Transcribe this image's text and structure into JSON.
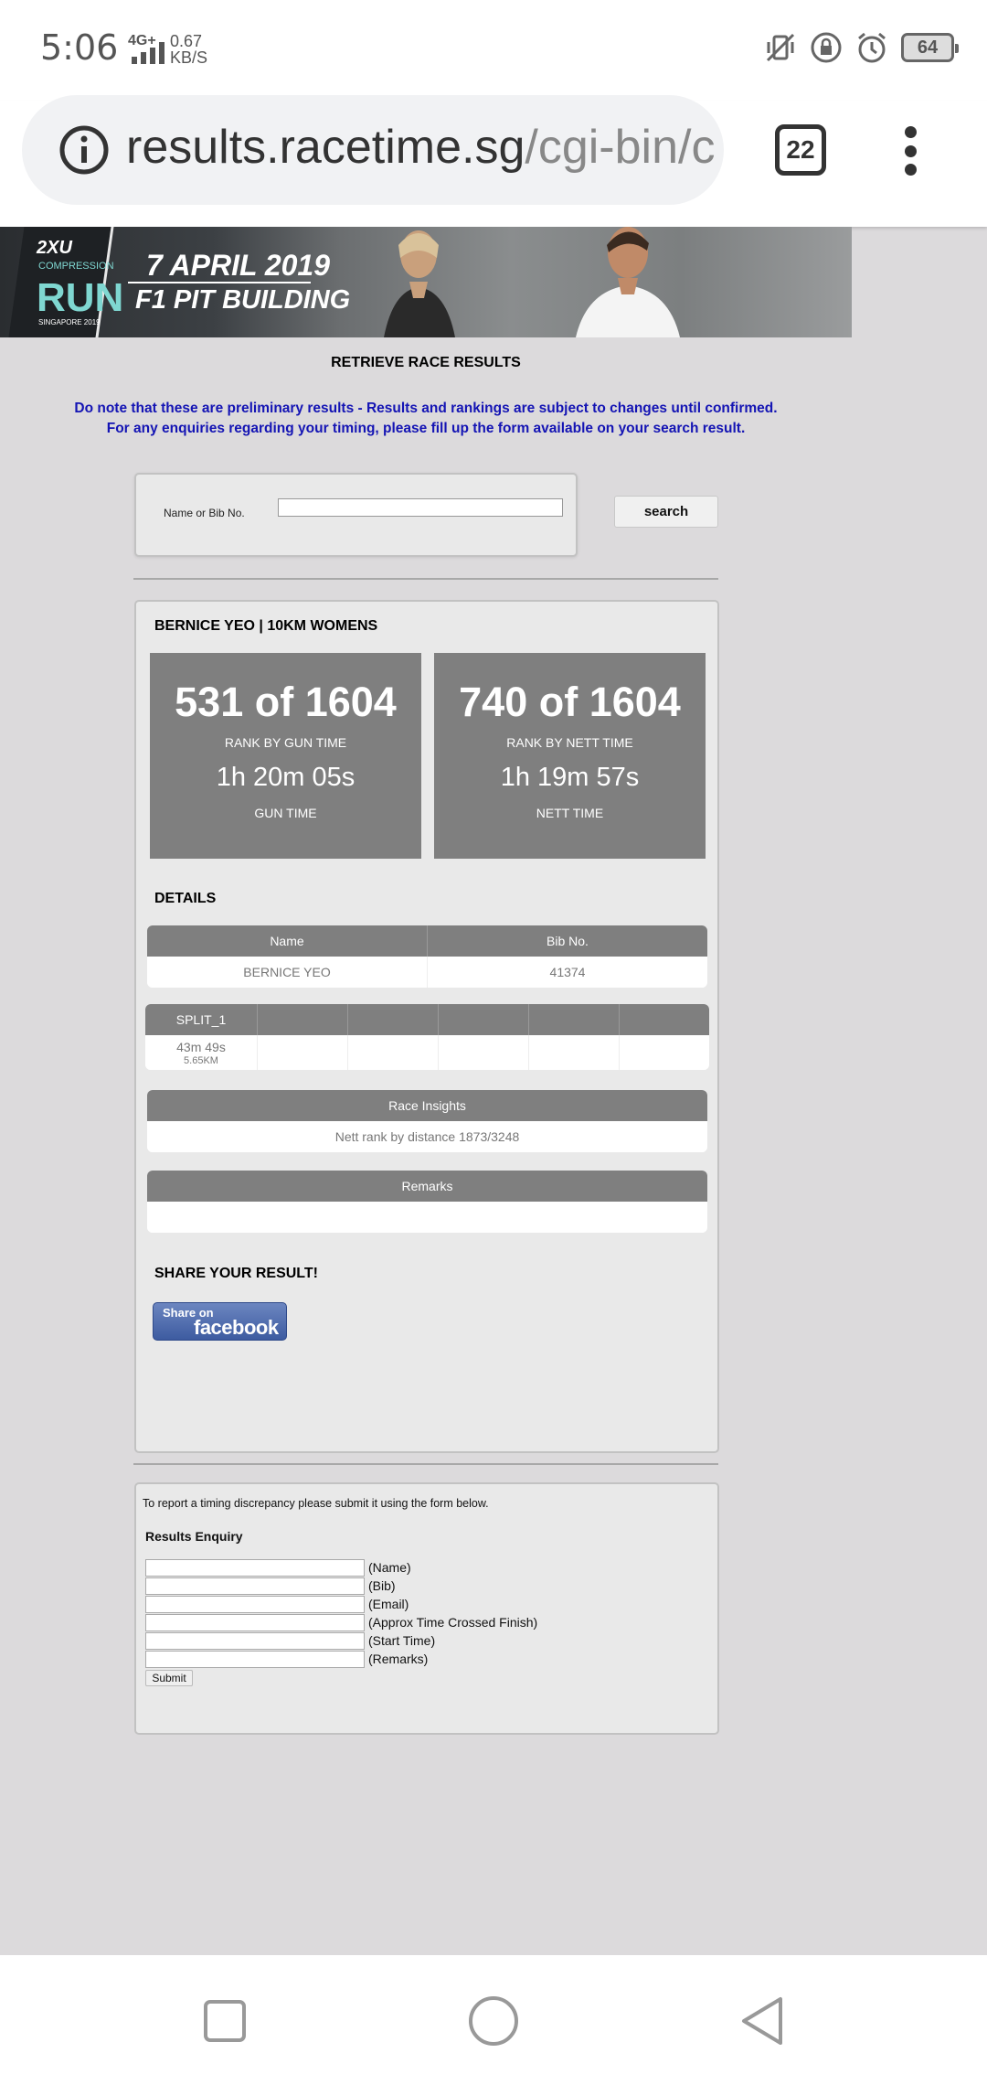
{
  "status_bar": {
    "time": "5:06",
    "network": "4G+",
    "speed_value": "0.67",
    "speed_unit": "KB/S",
    "battery": "64"
  },
  "browser": {
    "url_host": "results.racetime.sg",
    "url_path": "/cgi-bin/c",
    "tab_count": "22"
  },
  "banner": {
    "logo_brand": "2XU",
    "logo_sub": "COMPRESSION",
    "logo_run": "RUN",
    "logo_place": "SINGAPORE 2019",
    "date": "7 APRIL 2019",
    "venue": "F1 PIT BUILDING"
  },
  "page": {
    "title": "RETRIEVE RACE RESULTS",
    "notice_line1": "Do note that these are preliminary results - Results and rankings are subject to changes until confirmed.",
    "notice_line2": "For any enquiries regarding your timing, please fill up the form available on your search result."
  },
  "search": {
    "label": "Name or Bib No.",
    "value": "",
    "button": "search"
  },
  "result": {
    "athlete": "BERNICE YEO | 10KM WOMENS",
    "gun": {
      "rank": "531 of 1604",
      "rank_caption": "RANK BY GUN TIME",
      "time": "1h 20m 05s",
      "time_caption": "GUN TIME"
    },
    "nett": {
      "rank": "740 of 1604",
      "rank_caption": "RANK BY NETT TIME",
      "time": "1h 19m 57s",
      "time_caption": "NETT TIME"
    },
    "details_title": "DETAILS",
    "details": {
      "headers": [
        "Name",
        "Bib No."
      ],
      "values": [
        "BERNICE YEO",
        "41374"
      ]
    },
    "split": {
      "header": "SPLIT_1",
      "time": "43m 49s",
      "distance": "5.65KM"
    },
    "insights": {
      "header": "Race Insights",
      "value": "Nett rank by distance 1873/3248"
    },
    "remarks": {
      "header": "Remarks",
      "value": ""
    },
    "share_title": "SHARE YOUR RESULT!",
    "share_small": "Share on",
    "share_large": "facebook"
  },
  "enquiry": {
    "note": "To report a timing discrepancy please submit it using the form below.",
    "title": "Results Enquiry",
    "fields": [
      "(Name)",
      "(Bib)",
      "(Email)",
      "(Approx Time Crossed Finish)",
      "(Start Time)",
      "(Remarks)"
    ],
    "submit": "Submit"
  },
  "colors": {
    "notice_blue": "#1414b4",
    "box_gray": "#7f7f7f",
    "page_bg": "#dcdadc"
  }
}
